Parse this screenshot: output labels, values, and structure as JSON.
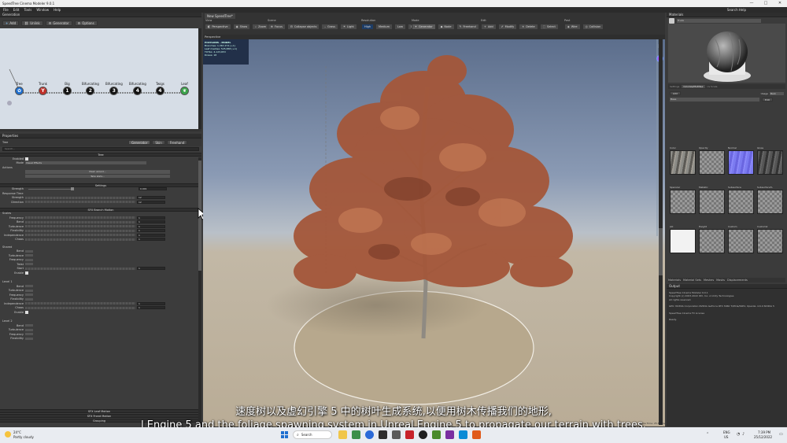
{
  "window": {
    "title": "SpeedTree Cinema Modeler 9.0.1",
    "menu": [
      "File",
      "Edit",
      "Tools",
      "Window",
      "Help"
    ],
    "search_help": "Search Help"
  },
  "generation_panel": {
    "title": "Generation",
    "toolbar": [
      "Add",
      "Unlink",
      "Generator",
      "Options"
    ],
    "nodes": [
      {
        "label": "Tree",
        "num": ""
      },
      {
        "label": "Trunk",
        "num": ""
      },
      {
        "label": "Big",
        "num": "1"
      },
      {
        "label": "Bifurcating",
        "num": "2"
      },
      {
        "label": "Bifurcating",
        "num": "3"
      },
      {
        "label": "Bifurcating",
        "num": "4"
      },
      {
        "label": "Twigs",
        "num": "4"
      },
      {
        "label": "Leaf",
        "num": ""
      }
    ]
  },
  "properties_panel": {
    "title": "Properties",
    "object": "Tree",
    "tabs": [
      "Generator",
      "Skin",
      "Freehand"
    ],
    "search_placeholder": "Search...",
    "sections": {
      "tree": "Tree",
      "enabled": "Enabled",
      "mode": "Mode",
      "mode_value": "Visual Effects",
      "actions": "Actions",
      "action_1": "Mesh wizard...",
      "action_2": "Take stats...",
      "settings": "Settings",
      "strength": "Strength",
      "strength_value": "0.901",
      "response_time": "Response Time",
      "rt_rows": [
        {
          "k": "Strength",
          "v": "12"
        },
        {
          "k": "Direction",
          "v": "12"
        }
      ],
      "branch_motion": "SFX Branch Motion",
      "scales": "Scales",
      "scales_rows": [
        "Frequency",
        "Bend",
        "Turbulence",
        "Flexibility",
        "Independence",
        "Chaos"
      ],
      "shared": "Shared",
      "shared_rows": [
        "Bend",
        "Turbulence",
        "Frequency",
        "Twist",
        "Start",
        "Enable"
      ],
      "level1": "Level 1",
      "level1_rows": [
        "Bend",
        "Turbulence",
        "Frequency",
        "Flexibility",
        "Independence",
        "Chaos",
        "Enable"
      ],
      "level2": "Level 2",
      "level2_rows": [
        "Bend",
        "Turbulence",
        "Frequency",
        "Flexibility"
      ],
      "leaf_motion": "SFX Leaf Motion",
      "frond_motion": "SFX Frond Motion",
      "grouping": "Grouping"
    },
    "row_value": "1"
  },
  "viewport": {
    "tab": "New SpeedTree*",
    "groups": [
      "View",
      "Scene",
      "Resolution",
      "Mode",
      "Edit",
      "Post"
    ],
    "buttons_view": [
      "Perspective",
      "Show",
      "Zoom"
    ],
    "buttons_scene": [
      "Focus",
      "Collapse objects",
      "Grass",
      "Light"
    ],
    "buttons_res": [
      "High",
      "Medium",
      "Low",
      "Draft"
    ],
    "buttons_mode": [
      "Generator",
      "Node",
      "Freehand"
    ],
    "buttons_edit": [
      "Add",
      "Modify",
      "Delete",
      "Select"
    ],
    "buttons_post": [
      "Wire",
      "Collision"
    ],
    "subheader": "Perspective",
    "stats": {
      "title": "POLYGONS - MODEL",
      "branches": "Branches: 1,367,274 (+1)",
      "leaf_meshes": "Leaf meshes: 525,658 (+1)",
      "total": "TOTAL: 4,123,653",
      "draws": "Draws: 18"
    },
    "frame_time": "Frame Time: 25.86 ms"
  },
  "materials_panel": {
    "title": "Materials",
    "material_name": "Trunk",
    "tabs": [
      "Settings",
      "Colorize/Mutlitex",
      "Uv Scale"
    ],
    "add": "Add",
    "usage_label": "Usage",
    "usage_value": "Bark",
    "map_name": "Base",
    "edit": "Edit",
    "maps": [
      "Color",
      "Opacity",
      "Normal",
      "Gloss",
      "Specular",
      "Metallic",
      "Subsurface",
      "Subsurface%",
      "AO",
      "Height",
      "Custom",
      "Custom2"
    ],
    "bottom_tabs": [
      "Materials",
      "Material Sets",
      "Meshes",
      "Masks",
      "Displacements"
    ]
  },
  "output_panel": {
    "title": "Output",
    "lines": [
      "SpeedTree Cinema Modeler 9.0.1",
      "Copyright (c) 2003-2022 IDV, Inc. A Unity Technologies",
      "All rights reserved.",
      "",
      "GPU: NVIDIA Corporation NVIDIA GeForce RTX 3060 Ti/PCIe/SSE2, OpenGL 4.6.0 NVIDIA 5",
      "",
      "SpeedTree Cinema FX License",
      "",
      "Ready."
    ]
  },
  "subtitles": {
    "cn": "速度树以及虚幻引擎 5 中的树叶生成系统,以便用树木传播我们的地形,",
    "en": "l Engine 5 and the foliage spawning system in Unreal Engine 5 to propagate our terrain with trees."
  },
  "taskbar": {
    "weather_temp": "24°C",
    "weather_desc": "Partly cloudy",
    "search": "Search",
    "lang": "ENG",
    "region": "US",
    "time": "7:39 PM",
    "date": "25/12/2022"
  },
  "colors": {
    "accent": "#1e6fd0",
    "tree_foliage": "#a4573a",
    "viewport_sky": "#6d7f9c",
    "viewport_ground": "#bfb29c"
  }
}
